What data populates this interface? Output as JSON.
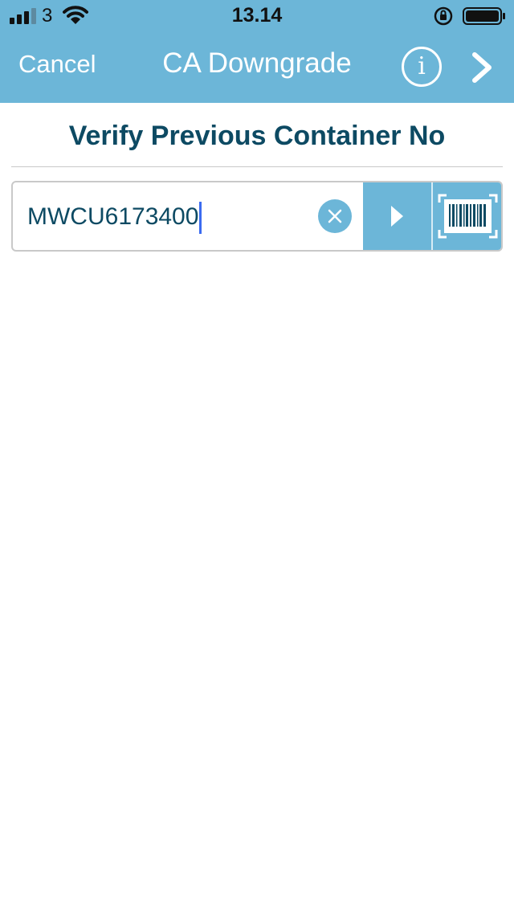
{
  "status_bar": {
    "carrier": "3",
    "time": "13.14",
    "icons": [
      "signal-icon",
      "wifi-icon",
      "orientation-lock-icon",
      "battery-icon"
    ]
  },
  "nav": {
    "cancel_label": "Cancel",
    "title": "CA Downgrade",
    "info_label": "i",
    "info_icon": "info-icon",
    "next_icon": "chevron-right-icon"
  },
  "page": {
    "title": "Verify Previous Container No"
  },
  "container_input": {
    "value": "MWCU6173400",
    "clear_icon": "clear-icon",
    "submit_icon": "play-arrow-icon",
    "scan_icon": "barcode-scan-icon"
  },
  "colors": {
    "header_bg": "#6cb6d8",
    "title_text": "#0d4a63",
    "caret": "#3b6bf0"
  }
}
